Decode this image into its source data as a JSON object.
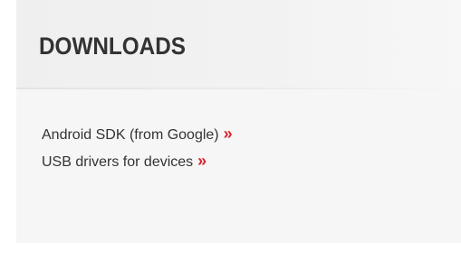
{
  "panel": {
    "title": "DOWNLOADS",
    "links": [
      {
        "label": "Android SDK (from Google)",
        "arrow": "»"
      },
      {
        "label": "USB drivers for devices",
        "arrow": "»"
      }
    ]
  },
  "colors": {
    "text": "#333333",
    "accent": "#d9232d",
    "panel_background": "#f6f6f6"
  }
}
